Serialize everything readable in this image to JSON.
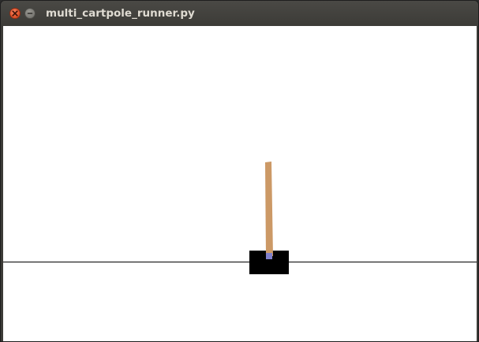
{
  "window": {
    "title": "multi_cartpole_runner.py",
    "close_icon": "close-icon",
    "minimize_icon": "minimize-icon"
  },
  "scene": {
    "background_color": "#ffffff",
    "track_color": "#000000",
    "cart_color": "#000000",
    "pole_color": "#cc9966",
    "axle_color": "#8080cc"
  }
}
